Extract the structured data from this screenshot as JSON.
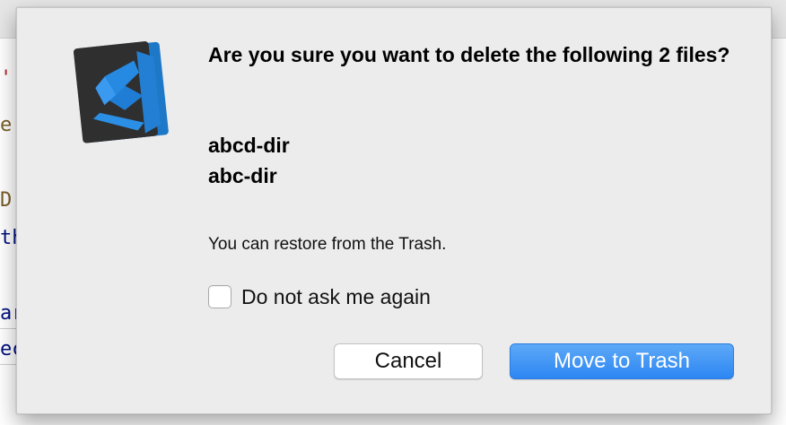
{
  "background": {
    "code_fragments": [
      {
        "text": "'",
        "color": "#b22222"
      },
      {
        "text": "e",
        "color": "#795e26"
      },
      {
        "text": "D",
        "color": "#795e26"
      },
      {
        "text": "th",
        "color": "#001080"
      },
      {
        "text": "ar",
        "color": "#001080"
      },
      {
        "text": "ec",
        "color": "#001080"
      }
    ]
  },
  "dialog": {
    "icon": "vscode-app-icon",
    "title": "Are you sure you want to delete the following 2 files?",
    "files": [
      "abcd-dir",
      "abc-dir"
    ],
    "info": "You can restore from the Trash.",
    "checkbox": {
      "label": "Do not ask me again",
      "checked": false
    },
    "buttons": {
      "cancel": "Cancel",
      "primary": "Move to Trash"
    },
    "colors": {
      "primary_button": "#3b8ff5",
      "dialog_background": "#ececec"
    }
  }
}
